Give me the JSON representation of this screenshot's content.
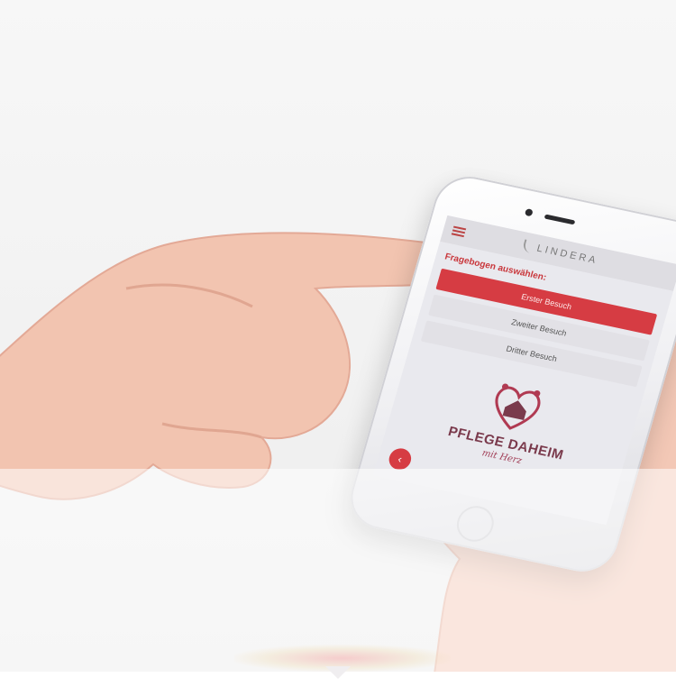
{
  "app": {
    "brand": "LINDERA",
    "prompt": "Fragebogen auswählen:",
    "visits": [
      "Erster Besuch",
      "Zweiter Besuch",
      "Dritter Besuch"
    ],
    "active_visit_index": 0,
    "logo_main": "PFLEGE DAHEIM",
    "logo_sub": "mit Herz",
    "back_symbol": "‹"
  },
  "icons": {
    "menu": "hamburger-menu-icon",
    "brand": "leaf-icon",
    "back": "chevron-left-icon",
    "logo": "heart-house-family-icon"
  },
  "colors": {
    "accent": "#d63c43",
    "logo_text": "#7a3a4c",
    "screen_bg": "#e9e9ee"
  }
}
